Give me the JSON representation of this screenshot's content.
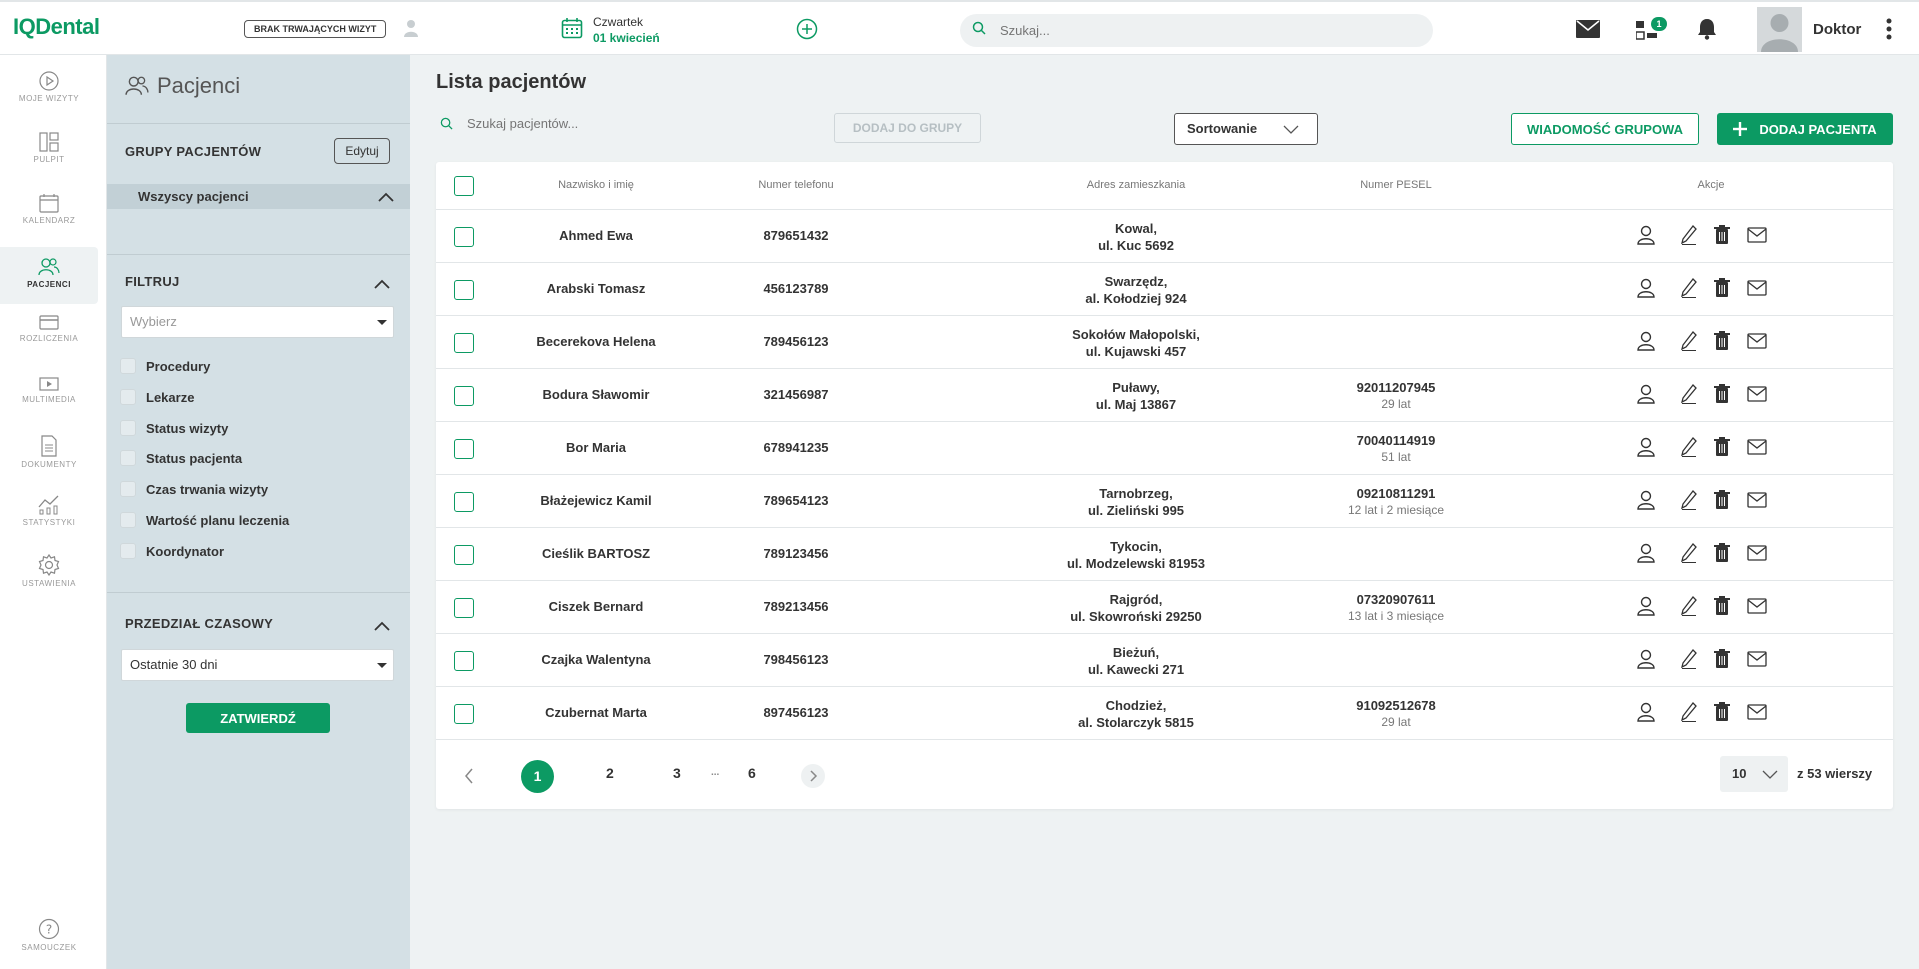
{
  "topbar": {
    "logo": "IQDental",
    "no_visits": "BRAK TRWAJĄCYCH WIZYT",
    "day": "Czwartek",
    "date": "01 kwiecień",
    "search_placeholder": "Szukaj...",
    "tasks_badge": "1",
    "user": "Doktor"
  },
  "nav": {
    "my_visits": "MOJE WIZYTY",
    "dashboard": "PULPIT",
    "calendar": "KALENDARZ",
    "patients": "PACJENCI",
    "billing": "ROZLICZENIA",
    "multimedia": "MULTIMEDIA",
    "documents": "DOKUMENTY",
    "stats": "STATYSTYKI",
    "settings": "USTAWIENIA",
    "tutorial": "SAMOUCZEK"
  },
  "sidepanel": {
    "title": "Pacjenci",
    "groups_title": "GRUPY PACJENTÓW",
    "edit": "Edytuj",
    "all_patients": "Wszyscy pacjenci",
    "filter_title": "FILTRUJ",
    "filter_select": "Wybierz",
    "filters": [
      "Procedury",
      "Lekarze",
      "Status wizyty",
      "Status pacjenta",
      "Czas trwania wizyty",
      "Wartość planu leczenia",
      "Koordynator"
    ],
    "time_title": "PRZEDZIAŁ CZASOWY",
    "time_select": "Ostatnie 30 dni",
    "confirm": "ZATWIERDŹ"
  },
  "main": {
    "title": "Lista pacjentów",
    "search_placeholder": "Szukaj pacjentów...",
    "add_to_group": "DODAJ DO GRUPY",
    "sort": "Sortowanie",
    "group_message": "WIADOMOŚĆ GRUPOWA",
    "add_patient": "DODAJ PACJENTA",
    "columns": {
      "name": "Nazwisko i imię",
      "phone": "Numer telefonu",
      "address": "Adres zamieszkania",
      "pesel": "Numer PESEL",
      "actions": "Akcje"
    },
    "rows": [
      {
        "name": "Ahmed Ewa",
        "phone": "879651432",
        "city": "Kowal,",
        "street": "ul. Kuc 5692",
        "pesel": "",
        "age": ""
      },
      {
        "name": "Arabski Tomasz",
        "phone": "456123789",
        "city": "Swarzędz,",
        "street": "al. Kołodziej 924",
        "pesel": "",
        "age": ""
      },
      {
        "name": "Becerekova Helena",
        "phone": "789456123",
        "city": "Sokołów Małopolski,",
        "street": "ul. Kujawski 457",
        "pesel": "",
        "age": ""
      },
      {
        "name": "Bodura Sławomir",
        "phone": "321456987",
        "city": "Puławy,",
        "street": "ul. Maj 13867",
        "pesel": "92011207945",
        "age": "29 lat"
      },
      {
        "name": "Bor Maria",
        "phone": "678941235",
        "city": "",
        "street": "",
        "pesel": "70040114919",
        "age": "51 lat"
      },
      {
        "name": "Błażejewicz Kamil",
        "phone": "789654123",
        "city": "Tarnobrzeg,",
        "street": "ul. Zieliński 995",
        "pesel": "09210811291",
        "age": "12 lat i 2 miesiące"
      },
      {
        "name": "Cieślik BARTOSZ",
        "phone": "789123456",
        "city": "Tykocin,",
        "street": "ul. Modzelewski 81953",
        "pesel": "",
        "age": ""
      },
      {
        "name": "Ciszek Bernard",
        "phone": "789213456",
        "city": "Rajgród,",
        "street": "ul. Skowroński 29250",
        "pesel": "07320907611",
        "age": "13 lat i 3 miesiące"
      },
      {
        "name": "Czajka Walentyna",
        "phone": "798456123",
        "city": "Bieżuń,",
        "street": "ul. Kawecki 271",
        "pesel": "",
        "age": ""
      },
      {
        "name": "Czubernat Marta",
        "phone": "897456123",
        "city": "Chodzież,",
        "street": "al. Stolarczyk 5815",
        "pesel": "91092512678",
        "age": "29 lat"
      }
    ],
    "pagination": {
      "pages": [
        "1",
        "2",
        "3",
        "6"
      ],
      "ellipsis": "...",
      "current": "1",
      "per_page": "10",
      "total": "z 53 wierszy"
    }
  },
  "colors": {
    "accent": "#0c9a63",
    "panel": "#d4e0e5",
    "background": "#eef2f3"
  }
}
